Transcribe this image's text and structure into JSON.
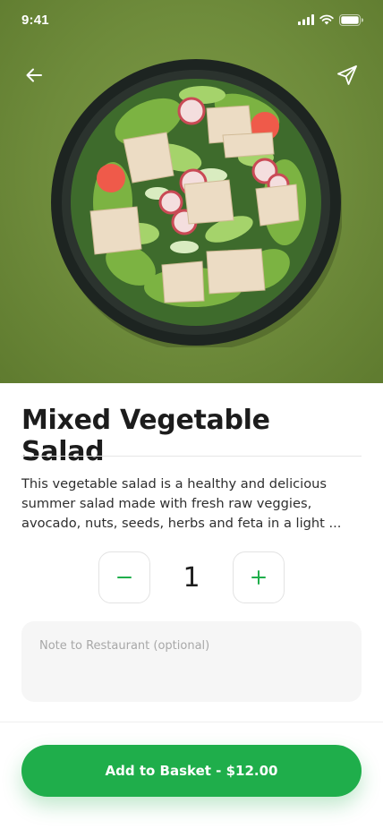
{
  "status_bar": {
    "time": "9:41"
  },
  "product": {
    "title": "Mixed Vegetable Salad",
    "description": "This vegetable salad is a healthy and delicious summer salad made with fresh raw veggies, avocado, nuts, seeds, herbs and feta in a light ..."
  },
  "quantity": {
    "value": "1"
  },
  "note": {
    "placeholder": "Note to Restaurant (optional)",
    "value": ""
  },
  "cta": {
    "label": "Add to Basket - $12.00"
  },
  "colors": {
    "accent": "#1fae4b",
    "hero_background": "#6e8b3b"
  }
}
